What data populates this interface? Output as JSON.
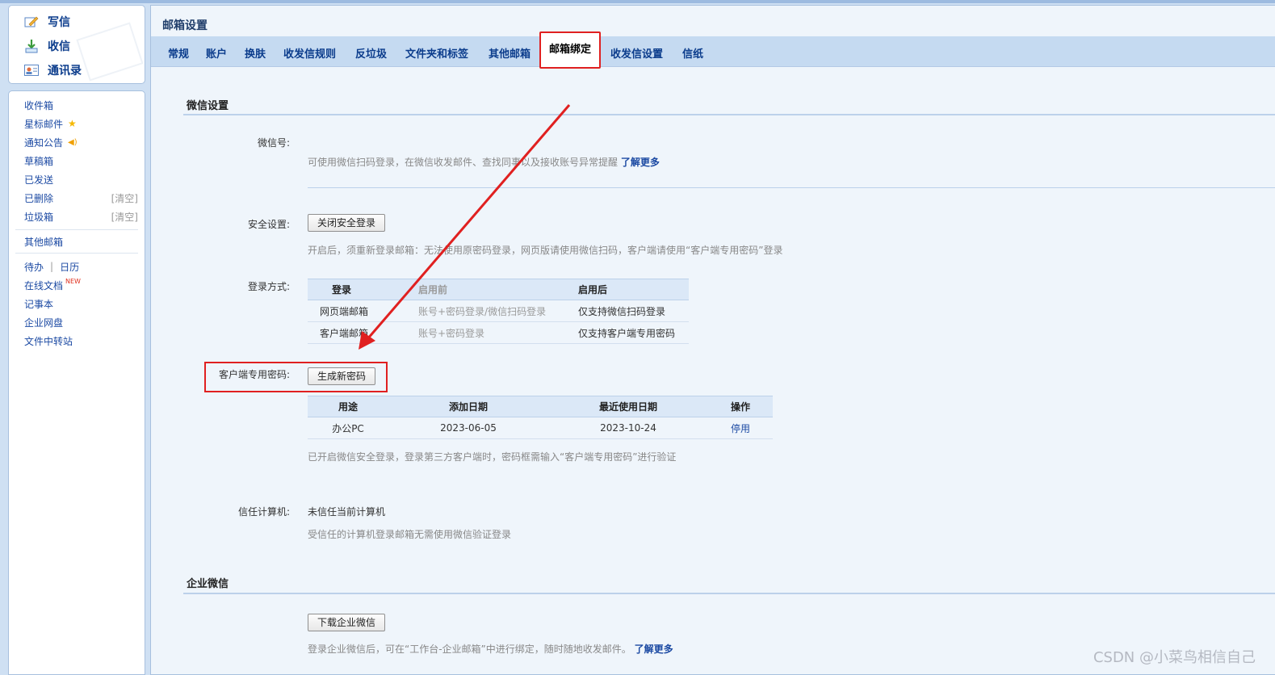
{
  "quick": {
    "compose": "写信",
    "inbox": "收信",
    "contacts": "通讯录"
  },
  "folders": {
    "inbox": "收件箱",
    "starred": "星标邮件",
    "notices": "通知公告",
    "drafts": "草稿箱",
    "sent": "已发送",
    "deleted": "已删除",
    "spam": "垃圾箱",
    "clear": "[清空]",
    "other_mail": "其他邮箱",
    "todo": "待办",
    "divider": "|",
    "calendar": "日历",
    "online_docs": "在线文档",
    "new_badge": "NEW",
    "notes": "记事本",
    "netdisk": "企业网盘",
    "transfer": "文件中转站"
  },
  "page_title": "邮箱设置",
  "tabs": [
    "常规",
    "账户",
    "换肤",
    "收发信规则",
    "反垃圾",
    "文件夹和标签",
    "其他邮箱",
    "邮箱绑定",
    "收发信设置",
    "信纸"
  ],
  "active_tab": "邮箱绑定",
  "wechat": {
    "section_title": "微信设置",
    "wechat_id_label": "微信号:",
    "wechat_id_hint": "可使用微信扫码登录，在微信收发邮件、查找同事以及接收账号异常提醒",
    "learn_more": "了解更多",
    "security_label": "安全设置:",
    "security_button": "关闭安全登录",
    "security_hint": "开启后，须重新登录邮箱：无法使用原密码登录，网页版请使用微信扫码，客户端请使用“客户端专用密码”登录",
    "login_method_label": "登录方式:",
    "login_table": {
      "headers": [
        "登录",
        "启用前",
        "启用后"
      ],
      "rows": [
        [
          "网页端邮箱",
          "账号+密码登录/微信扫码登录",
          "仅支持微信扫码登录"
        ],
        [
          "客户端邮箱",
          "账号+密码登录",
          "仅支持客户端专用密码"
        ]
      ]
    },
    "client_pwd_label": "客户端专用密码:",
    "client_pwd_button": "生成新密码",
    "pwd_table": {
      "headers": [
        "用途",
        "添加日期",
        "最近使用日期",
        "操作"
      ],
      "rows": [
        [
          "办公PC",
          "2023-06-05",
          "2023-10-24",
          "停用"
        ]
      ]
    },
    "client_pwd_hint": "已开启微信安全登录，登录第三方客户端时，密码框需输入“客户端专用密码”进行验证",
    "trusted_label": "信任计算机:",
    "trusted_value": "未信任当前计算机",
    "trusted_hint": "受信任的计算机登录邮箱无需使用微信验证登录"
  },
  "enterprise": {
    "section_title": "企业微信",
    "download_button": "下载企业微信",
    "hint": "登录企业微信后，可在“工作台-企业邮箱”中进行绑定，随时随地收发邮件。",
    "learn_more": "了解更多"
  },
  "watermark": "CSDN @小菜鸟相信自己",
  "colors": {
    "annotation_red": "#e02020",
    "link_blue": "#1c4aa3",
    "tab_bar": "#c5daf1",
    "panel_bg": "#eff5fb"
  }
}
